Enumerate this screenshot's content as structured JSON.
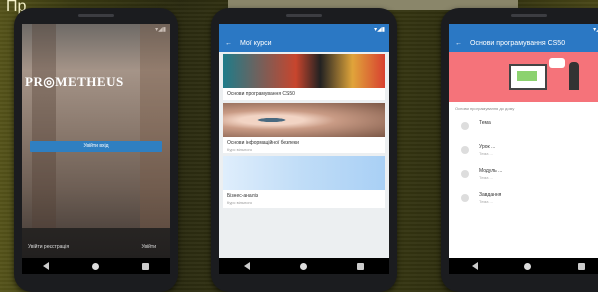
{
  "top_caption": "Пр... ...",
  "phones": {
    "login": {
      "logo": "PR◎METHEUS",
      "login_button": "Увійти вхід",
      "footer_left": "Увійти реєстрація",
      "footer_right": "Увійти"
    },
    "courses": {
      "appbar_title": "Мої курси",
      "status_time": "▾◢▮",
      "cards": [
        {
          "title": "Основи програмування CS50",
          "subtitle": ""
        },
        {
          "title": "Основи інформаційної безпеки",
          "subtitle": "Курс вільного"
        },
        {
          "title": "Бізнес-аналіз",
          "subtitle": "Курс вільного"
        }
      ]
    },
    "detail": {
      "appbar_title": "Основи програмування CS50",
      "tabs": "Основи програмування до дому",
      "items": [
        {
          "title": "Тема",
          "subtitle": ""
        },
        {
          "title": "Урок ...",
          "subtitle": "Тема ..."
        },
        {
          "title": "Модуль ...",
          "subtitle": "Тема ..."
        },
        {
          "title": "Завдання",
          "subtitle": "Тема ..."
        }
      ]
    }
  },
  "colors": {
    "accent_blue": "#2b78c4",
    "hero_coral": "#f5737a"
  }
}
